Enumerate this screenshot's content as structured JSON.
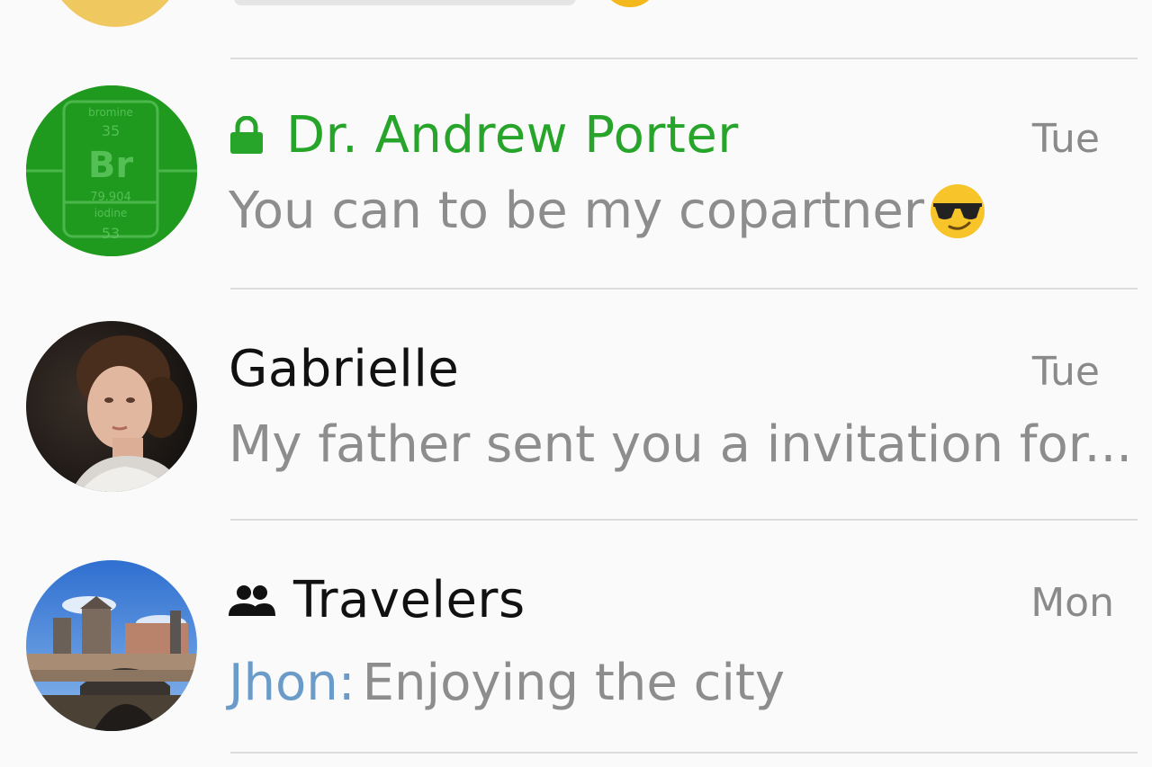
{
  "colors": {
    "secure_name": "#27a52b",
    "preview_text": "#8d8d8d",
    "group_sender": "#6a9bc9",
    "divider": "#dcdcdc"
  },
  "chats": [
    {
      "name": "Dr. Andrew Porter",
      "time": "Tue",
      "message": "You can to be my copartner",
      "secure": true,
      "icon": "lock-icon",
      "emoji": "sunglasses-emoji"
    },
    {
      "name": "Gabrielle",
      "time": "Tue",
      "message": "My father sent you a invitation for...",
      "secure": false
    },
    {
      "name": "Travelers",
      "time": "Mon",
      "sender": "Jhon:",
      "message": "Enjoying the city",
      "icon": "group-icon"
    }
  ]
}
